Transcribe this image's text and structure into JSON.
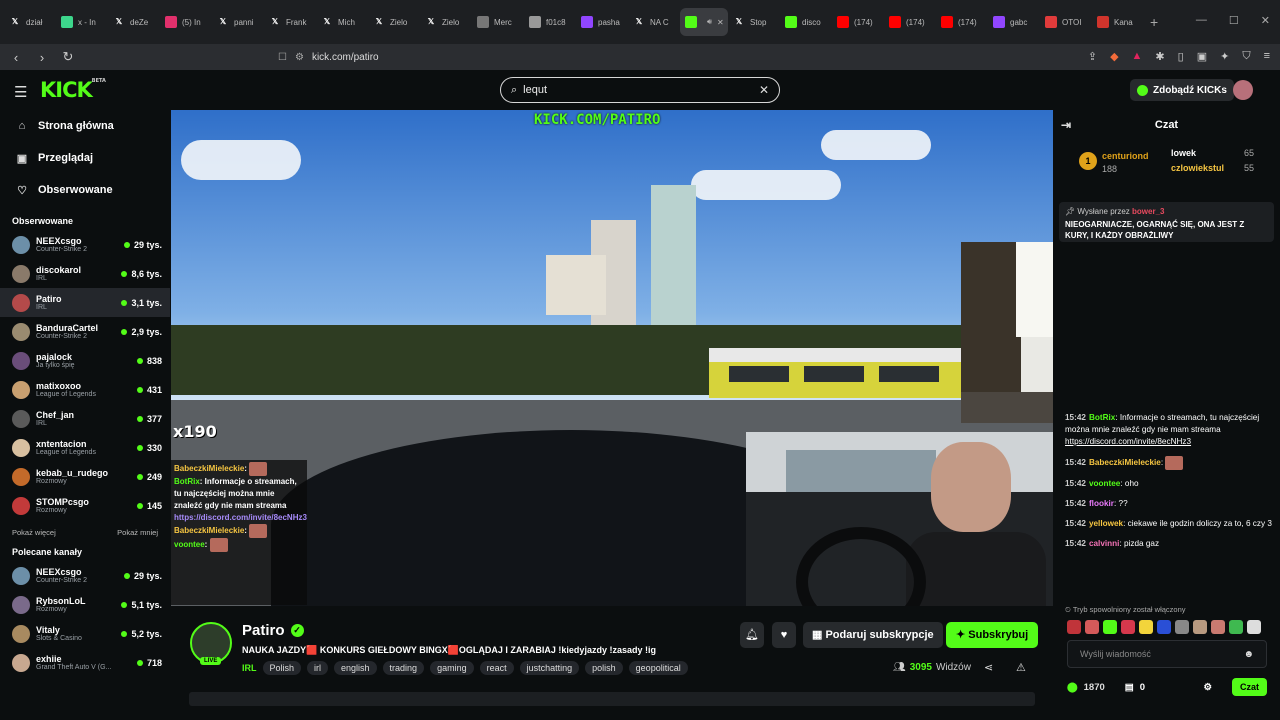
{
  "browser": {
    "tabs": [
      {
        "label": "dział",
        "icon": "x-icon",
        "color": "#ffffff"
      },
      {
        "label": "x - In",
        "icon": "app-icon",
        "color": "#3dd68c"
      },
      {
        "label": "deZe",
        "icon": "x-icon",
        "color": "#ffffff"
      },
      {
        "label": "(5) In",
        "icon": "instagram-icon",
        "color": "#e1306c"
      },
      {
        "label": "panni",
        "icon": "x-icon",
        "color": "#ffffff"
      },
      {
        "label": "Frank",
        "icon": "x-icon",
        "color": "#ffffff"
      },
      {
        "label": "Mich",
        "icon": "x-icon",
        "color": "#ffffff"
      },
      {
        "label": "Zielo",
        "icon": "x-icon",
        "color": "#ffffff"
      },
      {
        "label": "Zielo",
        "icon": "x-icon",
        "color": "#ffffff"
      },
      {
        "label": "Merc",
        "icon": "page-icon",
        "color": "#777777"
      },
      {
        "label": "f01c8",
        "icon": "globe-icon",
        "color": "#999999"
      },
      {
        "label": "pasha",
        "icon": "twitch-icon",
        "color": "#9146ff"
      },
      {
        "label": "NA C",
        "icon": "x-icon",
        "color": "#ffffff"
      },
      {
        "label": "",
        "icon": "kick-icon",
        "color": "#53fc18",
        "active": true
      },
      {
        "label": "Stop",
        "icon": "x-icon",
        "color": "#ffffff"
      },
      {
        "label": "disco",
        "icon": "kick-icon",
        "color": "#53fc18"
      },
      {
        "label": "(174)",
        "icon": "youtube-icon",
        "color": "#ff0000"
      },
      {
        "label": "(174)",
        "icon": "youtube-icon",
        "color": "#ff0000"
      },
      {
        "label": "(174)",
        "icon": "youtube-icon",
        "color": "#ff0000"
      },
      {
        "label": "gabc",
        "icon": "twitch-icon",
        "color": "#9146ff"
      },
      {
        "label": "OTOI",
        "icon": "otodom-icon",
        "color": "#e03b3b"
      },
      {
        "label": "Kana",
        "icon": "chart-icon",
        "color": "#d0342c"
      }
    ],
    "url": "kick.com/patiro"
  },
  "header": {
    "logo": "KICK",
    "logo_badge": "BETA",
    "search_value": "lequt",
    "kicks_button": "Zdobądź KICKs"
  },
  "sidebar": {
    "nav": [
      {
        "label": "Strona główna",
        "icon": "home-icon"
      },
      {
        "label": "Przeglądaj",
        "icon": "browse-icon"
      },
      {
        "label": "Obserwowane",
        "icon": "heart-icon"
      }
    ],
    "followed_title": "Obserwowane",
    "followed": [
      {
        "name": "NEEXcsgo",
        "category": "Counter-Strike 2",
        "viewers": "29 tys.",
        "color": "#6c8fa8"
      },
      {
        "name": "discokarol",
        "category": "IRL",
        "viewers": "8,6 tys.",
        "color": "#8a7a6a"
      },
      {
        "name": "Patiro",
        "category": "IRL",
        "viewers": "3,1 tys.",
        "color": "#b44a4a",
        "selected": true
      },
      {
        "name": "BanduraCartel",
        "category": "Counter-Strike 2",
        "viewers": "2,9 tys.",
        "color": "#9a8b70"
      },
      {
        "name": "pajalock",
        "category": "Ja tylko śpię",
        "viewers": "838",
        "color": "#6a4d7a"
      },
      {
        "name": "matixoxoo",
        "category": "League of Legends",
        "viewers": "431",
        "color": "#c9a070"
      },
      {
        "name": "Chef_jan",
        "category": "IRL",
        "viewers": "377",
        "color": "#5a5a5a"
      },
      {
        "name": "xntentacion",
        "category": "League of Legends",
        "viewers": "330",
        "color": "#d8c0a0"
      },
      {
        "name": "kebab_u_rudego",
        "category": "Rozmowy",
        "viewers": "249",
        "color": "#c36a2a"
      },
      {
        "name": "STOMPcsgo",
        "category": "Rozmowy",
        "viewers": "145",
        "color": "#c23a3a"
      }
    ],
    "show_more": "Pokaż więcej",
    "show_less": "Pokaż mniej",
    "recommended_title": "Polecane kanały",
    "recommended": [
      {
        "name": "NEEXcsgo",
        "category": "Counter-Strike 2",
        "viewers": "29 tys.",
        "color": "#6c8fa8"
      },
      {
        "name": "RybsonLoL",
        "category": "Rozmowy",
        "viewers": "5,1 tys.",
        "color": "#7a6a8a"
      },
      {
        "name": "Vitaly",
        "category": "Slots & Casino",
        "viewers": "5,2 tys.",
        "color": "#a88a60"
      },
      {
        "name": "exhiie",
        "category": "Grand Theft Auto V (G...",
        "viewers": "718",
        "color": "#c8a890"
      }
    ]
  },
  "video": {
    "overlay_url": "KICK.COM/PATIRO",
    "combo": "x190",
    "overlay_chat": [
      {
        "user": "BabeczkiMieleckie",
        "text": ":",
        "color": "#f5c542"
      },
      {
        "user": "BotRix",
        "text": ": Informacje o streamach, tu najczęściej można mnie znaleźć gdy nie mam streama",
        "color": "#53fc18"
      },
      {
        "user": "",
        "text": "https://discord.com/invite/8ecNHz3",
        "color": "#a78bfa"
      },
      {
        "user": "BabeczkiMieleckie",
        "text": ":",
        "color": "#f5c542"
      },
      {
        "user": "voontee",
        "text": ":",
        "color": "#53fc18"
      }
    ]
  },
  "stream": {
    "channel": "Patiro",
    "live_badge": "LIVE",
    "title": "NAUKA JAZDY🟥 KONKURS GIEŁDOWY BINGX🟥OGLĄDAJ I ZARABIAJ !kiedyjazdy !zasady !ig",
    "category": "IRL",
    "tags": [
      "Polish",
      "irl",
      "english",
      "trading",
      "gaming",
      "react",
      "justchatting",
      "polish",
      "geopolitical"
    ],
    "gift_button": "Podaruj subskrypcje",
    "subscribe_button": "Subskrybuj",
    "viewers_count": "3095",
    "viewers_label": "Widzów"
  },
  "chat": {
    "title": "Czat",
    "gifters": [
      {
        "rank": "1",
        "name": "centuriond",
        "amount": "188"
      },
      {
        "name": "lowek",
        "amount": "65"
      },
      {
        "name": "czlowiekstul",
        "amount": "55"
      }
    ],
    "pinned_by_label": "Wysłane przez",
    "pinned_by_user": "bower_3",
    "pinned_text": "NIEOGARNIACZE, OGARNĄĆ SIĘ, ONA JEST Z KURY, I KAŻDY OBRAŻLIWY",
    "messages": [
      {
        "time": "15:42",
        "user": "BotRix",
        "text": ": Informacje o streamach, tu najczęściej można mnie znaleźć gdy nie mam streama",
        "link": "https://discord.com/invite/8ecNHz3",
        "color": "#53fc18"
      },
      {
        "time": "15:42",
        "user": "BabeczkiMieleckie",
        "text": ":",
        "color": "#f5c542",
        "emote": true
      },
      {
        "time": "15:42",
        "user": "voontee",
        "text": ": oho",
        "color": "#53fc18"
      },
      {
        "time": "15:42",
        "user": "flookir",
        "text": ": ??",
        "color": "#e879f9"
      },
      {
        "time": "15:42",
        "user": "yellowek",
        "text": ": ciekawe ile godzin doliczy za to, 6 czy 3",
        "color": "#f5c542"
      },
      {
        "time": "15:42",
        "user": "calvinni",
        "text": ": pizda gaz",
        "color": "#f472b6"
      }
    ],
    "slow_mode": "Tryb spowolniony został włączony",
    "input_placeholder": "Wyślij wiadomość",
    "points": "1870",
    "chest_count": "0",
    "send_button": "Czat"
  }
}
